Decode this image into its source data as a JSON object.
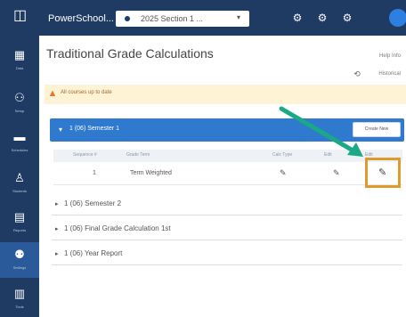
{
  "header": {
    "brand": "PowerSchool...",
    "year_select": "2025 Section 1 ..."
  },
  "sidebar": {
    "items": [
      {
        "label": "Data"
      },
      {
        "label": "Setup"
      },
      {
        "label": "Schedules"
      },
      {
        "label": "Students"
      },
      {
        "label": "Reports"
      },
      {
        "label": "Settings"
      },
      {
        "label": "Tools"
      }
    ]
  },
  "page": {
    "title": "Traditional Grade Calculations",
    "top_right_link": "Help Info",
    "top_right_link2": "Historical"
  },
  "warning": {
    "text": "All courses up to date"
  },
  "sections": {
    "expanded": {
      "title": "1 (06) Semester 1",
      "action_label": "Create New",
      "columns": [
        "Sequence #",
        "Grade Term",
        "Calc Type",
        "Edit",
        "Edit"
      ],
      "rows": [
        {
          "sequence": "1",
          "term": "Term Weighted"
        }
      ]
    },
    "collapsed": [
      {
        "title": "1 (06) Semester 2"
      },
      {
        "title": "1 (06) Final Grade Calculation 1st"
      },
      {
        "title": "1 (06) Year Report"
      }
    ]
  },
  "colors": {
    "nav_bg": "#1f3b63",
    "section_head": "#2f79cf",
    "highlight": "#e09a2c",
    "arrow": "#1aa886",
    "warning_bg": "#fff3d6"
  }
}
